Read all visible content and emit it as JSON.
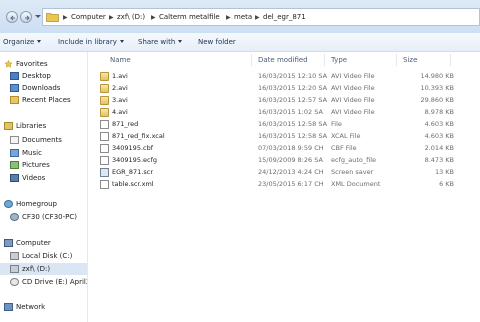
{
  "address": {
    "segments": [
      "Computer",
      "zxf\\ (D:)",
      "Calterm metalfile",
      "meta",
      "del_egr_871"
    ]
  },
  "toolbar": {
    "organize": "Organize",
    "include_in_library": "Include in library",
    "share_with": "Share with",
    "new_folder": "New folder"
  },
  "nav": {
    "favorites": "Favorites",
    "desktop": "Desktop",
    "downloads": "Downloads",
    "recent_places": "Recent Places",
    "libraries": "Libraries",
    "documents": "Documents",
    "music": "Music",
    "pictures": "Pictures",
    "videos": "Videos",
    "homegroup": "Homegroup",
    "cf30": "CF30 (CF30-PC)",
    "computer": "Computer",
    "local_disk": "Local Disk (C:)",
    "zxf": "zxf\\ (D:)",
    "cd_drive": "CD Drive (E:) April20",
    "network": "Network"
  },
  "columns": {
    "name": "Name",
    "date_modified": "Date modified",
    "type": "Type",
    "size": "Size"
  },
  "files": [
    {
      "name": "1.avi",
      "date": "16/03/2015 12:10 SA",
      "type": "AVI Video File",
      "size": "14.980 KB",
      "icon": "avi-file-icon"
    },
    {
      "name": "2.avi",
      "date": "16/03/2015 12:20 SA",
      "type": "AVI Video File",
      "size": "10.393 KB",
      "icon": "avi-file-icon"
    },
    {
      "name": "3.avi",
      "date": "16/03/2015 12:57 SA",
      "type": "AVI Video File",
      "size": "29.860 KB",
      "icon": "avi-file-icon"
    },
    {
      "name": "4.avi",
      "date": "16/03/2015 1:02 SA",
      "type": "AVI Video File",
      "size": "8.978 KB",
      "icon": "avi-file-icon"
    },
    {
      "name": "871_red",
      "date": "16/03/2015 12:58 SA",
      "type": "File",
      "size": "4.603 KB",
      "icon": "generic-file-icon"
    },
    {
      "name": "871_red_fix.xcal",
      "date": "16/03/2015 12:58 SA",
      "type": "XCAL File",
      "size": "4.603 KB",
      "icon": "generic-file-icon"
    },
    {
      "name": "3409195.cbf",
      "date": "07/03/2018 9:59 CH",
      "type": "CBF File",
      "size": "2.014 KB",
      "icon": "generic-file-icon"
    },
    {
      "name": "3409195.ecfg",
      "date": "15/09/2009 8:26 SA",
      "type": "ecfg_auto_file",
      "size": "8.473 KB",
      "icon": "generic-file-icon"
    },
    {
      "name": "EGR_871.scr",
      "date": "24/12/2013 4:24 CH",
      "type": "Screen saver",
      "size": "13 KB",
      "icon": "screensaver-file-icon"
    },
    {
      "name": "table.scr.xml",
      "date": "23/05/2015 6:17 CH",
      "type": "XML Document",
      "size": "6 KB",
      "icon": "xml-file-icon"
    }
  ]
}
